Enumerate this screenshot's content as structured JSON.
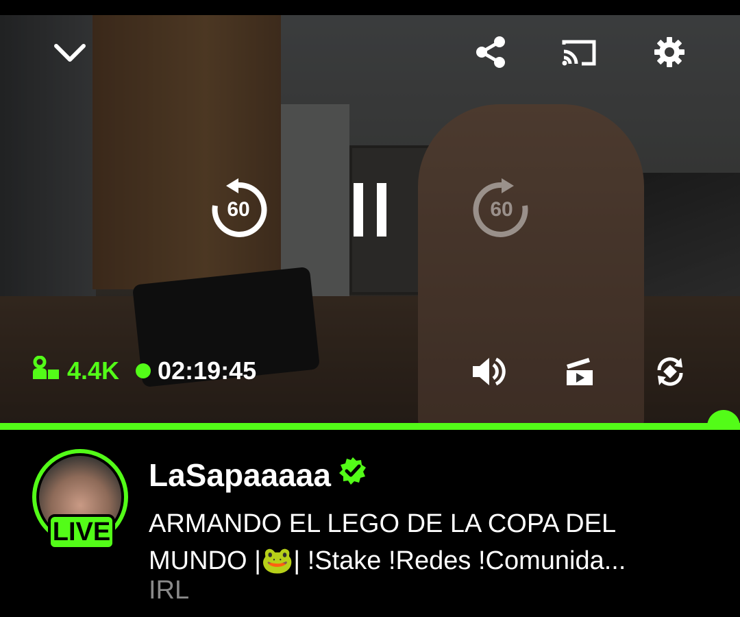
{
  "player": {
    "icons": {
      "collapse": "chevron-down-icon",
      "share": "share-icon",
      "cast": "cast-icon",
      "settings": "gear-icon",
      "rewind": "rewind-60-icon",
      "pause": "pause-icon",
      "forward": "forward-60-icon",
      "volume": "volume-icon",
      "theater": "theater-mode-icon",
      "rotate": "rotate-screen-icon"
    },
    "rewind_label": "60",
    "forward_label": "60",
    "viewer_count": "4.4K",
    "elapsed": "02:19:45",
    "progress_fraction": 1.0,
    "accent_color": "#53fc18"
  },
  "stream": {
    "channel_name": "LaSapaaaaa",
    "verified": true,
    "live_label": "LIVE",
    "title": "ARMANDO EL LEGO DE LA COPA DEL MUNDO |🐸| !Stake !Redes !Comunida...",
    "category": "IRL"
  }
}
